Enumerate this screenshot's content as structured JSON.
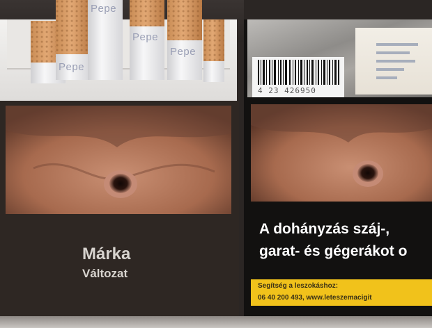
{
  "cigarette_imprint": "Pepe",
  "left_pack": {
    "brand": "Márka",
    "variant": "Változat"
  },
  "right_pack": {
    "barcode_number": "4 23 426950",
    "warning_line_1": "A dohányzás száj-,",
    "warning_line_2": "garat- és gégerákot o",
    "help_line_1": "Segítség a leszokáshoz:",
    "help_line_2": "06 40 200 493, www.leteszemacigit"
  },
  "colors": {
    "pack_dark": "#2e2723",
    "warning_bg": "#121110",
    "help_yellow": "#f1c21b",
    "filter_tan": "#d99a62"
  }
}
